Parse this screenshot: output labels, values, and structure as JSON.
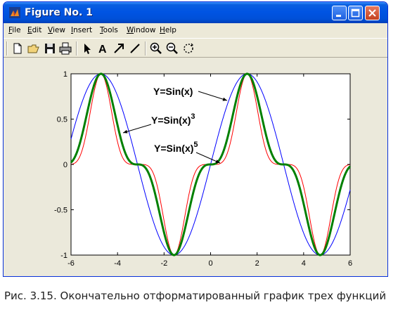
{
  "window": {
    "title": "Figure No. 1",
    "titlebar_color": "#0054e3"
  },
  "menu": {
    "items": [
      {
        "label": "File",
        "accel": "F"
      },
      {
        "label": "Edit",
        "accel": "E"
      },
      {
        "label": "View",
        "accel": "V"
      },
      {
        "label": "Insert",
        "accel": "I"
      },
      {
        "label": "Tools",
        "accel": "T"
      },
      {
        "label": "Window",
        "accel": "W"
      },
      {
        "label": "Help",
        "accel": "H"
      }
    ]
  },
  "toolbar": {
    "tools": [
      "new-file-icon",
      "open-file-icon",
      "save-icon",
      "print-icon",
      "pointer-icon",
      "insert-text-icon",
      "insert-arrow-icon",
      "insert-line-icon",
      "zoom-in-icon",
      "zoom-out-icon",
      "rotate-icon"
    ]
  },
  "chart_data": {
    "type": "line",
    "title": "",
    "xlabel": "",
    "ylabel": "",
    "xlim": [
      -6,
      6
    ],
    "ylim": [
      -1,
      1
    ],
    "xticks": [
      "-6",
      "-4",
      "-2",
      "0",
      "2",
      "4",
      "6"
    ],
    "yticks": [
      "1",
      "0.5",
      "0",
      "-0.5",
      "-1"
    ],
    "grid": false,
    "series": [
      {
        "name": "Y=Sin(x)",
        "function": "sin(x)",
        "color": "#0000ff",
        "width": 1
      },
      {
        "name": "Y=Sin(x)^3",
        "function": "sin(x)^3",
        "color": "#008000",
        "width": 3
      },
      {
        "name": "Y=Sin(x)^5",
        "function": "sin(x)^5",
        "color": "#ff0000",
        "width": 1
      }
    ],
    "annotations": [
      {
        "base": "Y=Sin(x)",
        "exp": ""
      },
      {
        "base": "Y=Sin(x)",
        "exp": "3"
      },
      {
        "base": "Y=Sin(x)",
        "exp": "5"
      }
    ]
  },
  "caption": {
    "prefix": "Рис. 3.15.",
    "text": " Окончательно отформатированный график трех функций"
  }
}
